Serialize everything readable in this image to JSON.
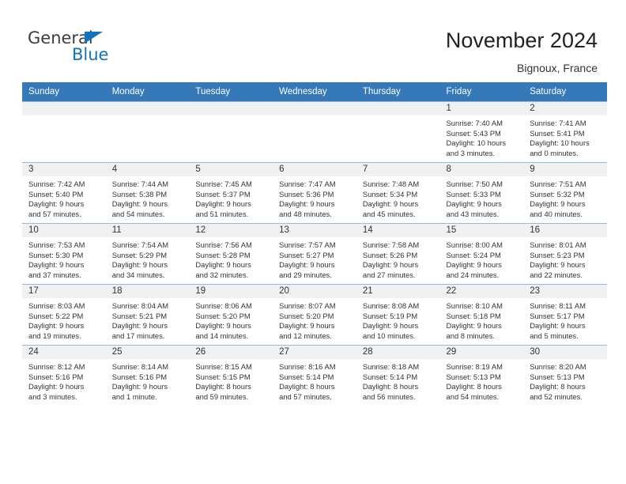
{
  "brand": {
    "name_part1": "General",
    "name_part2": "Blue",
    "triangle_color": "#1272bd",
    "text_color": "#3d3d3d"
  },
  "header": {
    "title": "November 2024",
    "location": "Bignoux, France"
  },
  "calendar": {
    "header_bg": "#3579b8",
    "header_text_color": "#ffffff",
    "daynum_band_bg": "#f1f1f1",
    "grid_line_color": "#9cb8d0",
    "weekdays": [
      "Sunday",
      "Monday",
      "Tuesday",
      "Wednesday",
      "Thursday",
      "Friday",
      "Saturday"
    ],
    "weeks": [
      [
        {
          "day": "",
          "empty": true
        },
        {
          "day": "",
          "empty": true
        },
        {
          "day": "",
          "empty": true
        },
        {
          "day": "",
          "empty": true
        },
        {
          "day": "",
          "empty": true
        },
        {
          "day": "1",
          "sunrise": "Sunrise: 7:40 AM",
          "sunset": "Sunset: 5:43 PM",
          "daylight_l1": "Daylight: 10 hours",
          "daylight_l2": "and 3 minutes."
        },
        {
          "day": "2",
          "sunrise": "Sunrise: 7:41 AM",
          "sunset": "Sunset: 5:41 PM",
          "daylight_l1": "Daylight: 10 hours",
          "daylight_l2": "and 0 minutes."
        }
      ],
      [
        {
          "day": "3",
          "sunrise": "Sunrise: 7:42 AM",
          "sunset": "Sunset: 5:40 PM",
          "daylight_l1": "Daylight: 9 hours",
          "daylight_l2": "and 57 minutes."
        },
        {
          "day": "4",
          "sunrise": "Sunrise: 7:44 AM",
          "sunset": "Sunset: 5:38 PM",
          "daylight_l1": "Daylight: 9 hours",
          "daylight_l2": "and 54 minutes."
        },
        {
          "day": "5",
          "sunrise": "Sunrise: 7:45 AM",
          "sunset": "Sunset: 5:37 PM",
          "daylight_l1": "Daylight: 9 hours",
          "daylight_l2": "and 51 minutes."
        },
        {
          "day": "6",
          "sunrise": "Sunrise: 7:47 AM",
          "sunset": "Sunset: 5:36 PM",
          "daylight_l1": "Daylight: 9 hours",
          "daylight_l2": "and 48 minutes."
        },
        {
          "day": "7",
          "sunrise": "Sunrise: 7:48 AM",
          "sunset": "Sunset: 5:34 PM",
          "daylight_l1": "Daylight: 9 hours",
          "daylight_l2": "and 45 minutes."
        },
        {
          "day": "8",
          "sunrise": "Sunrise: 7:50 AM",
          "sunset": "Sunset: 5:33 PM",
          "daylight_l1": "Daylight: 9 hours",
          "daylight_l2": "and 43 minutes."
        },
        {
          "day": "9",
          "sunrise": "Sunrise: 7:51 AM",
          "sunset": "Sunset: 5:32 PM",
          "daylight_l1": "Daylight: 9 hours",
          "daylight_l2": "and 40 minutes."
        }
      ],
      [
        {
          "day": "10",
          "sunrise": "Sunrise: 7:53 AM",
          "sunset": "Sunset: 5:30 PM",
          "daylight_l1": "Daylight: 9 hours",
          "daylight_l2": "and 37 minutes."
        },
        {
          "day": "11",
          "sunrise": "Sunrise: 7:54 AM",
          "sunset": "Sunset: 5:29 PM",
          "daylight_l1": "Daylight: 9 hours",
          "daylight_l2": "and 34 minutes."
        },
        {
          "day": "12",
          "sunrise": "Sunrise: 7:56 AM",
          "sunset": "Sunset: 5:28 PM",
          "daylight_l1": "Daylight: 9 hours",
          "daylight_l2": "and 32 minutes."
        },
        {
          "day": "13",
          "sunrise": "Sunrise: 7:57 AM",
          "sunset": "Sunset: 5:27 PM",
          "daylight_l1": "Daylight: 9 hours",
          "daylight_l2": "and 29 minutes."
        },
        {
          "day": "14",
          "sunrise": "Sunrise: 7:58 AM",
          "sunset": "Sunset: 5:26 PM",
          "daylight_l1": "Daylight: 9 hours",
          "daylight_l2": "and 27 minutes."
        },
        {
          "day": "15",
          "sunrise": "Sunrise: 8:00 AM",
          "sunset": "Sunset: 5:24 PM",
          "daylight_l1": "Daylight: 9 hours",
          "daylight_l2": "and 24 minutes."
        },
        {
          "day": "16",
          "sunrise": "Sunrise: 8:01 AM",
          "sunset": "Sunset: 5:23 PM",
          "daylight_l1": "Daylight: 9 hours",
          "daylight_l2": "and 22 minutes."
        }
      ],
      [
        {
          "day": "17",
          "sunrise": "Sunrise: 8:03 AM",
          "sunset": "Sunset: 5:22 PM",
          "daylight_l1": "Daylight: 9 hours",
          "daylight_l2": "and 19 minutes."
        },
        {
          "day": "18",
          "sunrise": "Sunrise: 8:04 AM",
          "sunset": "Sunset: 5:21 PM",
          "daylight_l1": "Daylight: 9 hours",
          "daylight_l2": "and 17 minutes."
        },
        {
          "day": "19",
          "sunrise": "Sunrise: 8:06 AM",
          "sunset": "Sunset: 5:20 PM",
          "daylight_l1": "Daylight: 9 hours",
          "daylight_l2": "and 14 minutes."
        },
        {
          "day": "20",
          "sunrise": "Sunrise: 8:07 AM",
          "sunset": "Sunset: 5:20 PM",
          "daylight_l1": "Daylight: 9 hours",
          "daylight_l2": "and 12 minutes."
        },
        {
          "day": "21",
          "sunrise": "Sunrise: 8:08 AM",
          "sunset": "Sunset: 5:19 PM",
          "daylight_l1": "Daylight: 9 hours",
          "daylight_l2": "and 10 minutes."
        },
        {
          "day": "22",
          "sunrise": "Sunrise: 8:10 AM",
          "sunset": "Sunset: 5:18 PM",
          "daylight_l1": "Daylight: 9 hours",
          "daylight_l2": "and 8 minutes."
        },
        {
          "day": "23",
          "sunrise": "Sunrise: 8:11 AM",
          "sunset": "Sunset: 5:17 PM",
          "daylight_l1": "Daylight: 9 hours",
          "daylight_l2": "and 5 minutes."
        }
      ],
      [
        {
          "day": "24",
          "sunrise": "Sunrise: 8:12 AM",
          "sunset": "Sunset: 5:16 PM",
          "daylight_l1": "Daylight: 9 hours",
          "daylight_l2": "and 3 minutes."
        },
        {
          "day": "25",
          "sunrise": "Sunrise: 8:14 AM",
          "sunset": "Sunset: 5:16 PM",
          "daylight_l1": "Daylight: 9 hours",
          "daylight_l2": "and 1 minute."
        },
        {
          "day": "26",
          "sunrise": "Sunrise: 8:15 AM",
          "sunset": "Sunset: 5:15 PM",
          "daylight_l1": "Daylight: 8 hours",
          "daylight_l2": "and 59 minutes."
        },
        {
          "day": "27",
          "sunrise": "Sunrise: 8:16 AM",
          "sunset": "Sunset: 5:14 PM",
          "daylight_l1": "Daylight: 8 hours",
          "daylight_l2": "and 57 minutes."
        },
        {
          "day": "28",
          "sunrise": "Sunrise: 8:18 AM",
          "sunset": "Sunset: 5:14 PM",
          "daylight_l1": "Daylight: 8 hours",
          "daylight_l2": "and 56 minutes."
        },
        {
          "day": "29",
          "sunrise": "Sunrise: 8:19 AM",
          "sunset": "Sunset: 5:13 PM",
          "daylight_l1": "Daylight: 8 hours",
          "daylight_l2": "and 54 minutes."
        },
        {
          "day": "30",
          "sunrise": "Sunrise: 8:20 AM",
          "sunset": "Sunset: 5:13 PM",
          "daylight_l1": "Daylight: 8 hours",
          "daylight_l2": "and 52 minutes."
        }
      ]
    ]
  }
}
